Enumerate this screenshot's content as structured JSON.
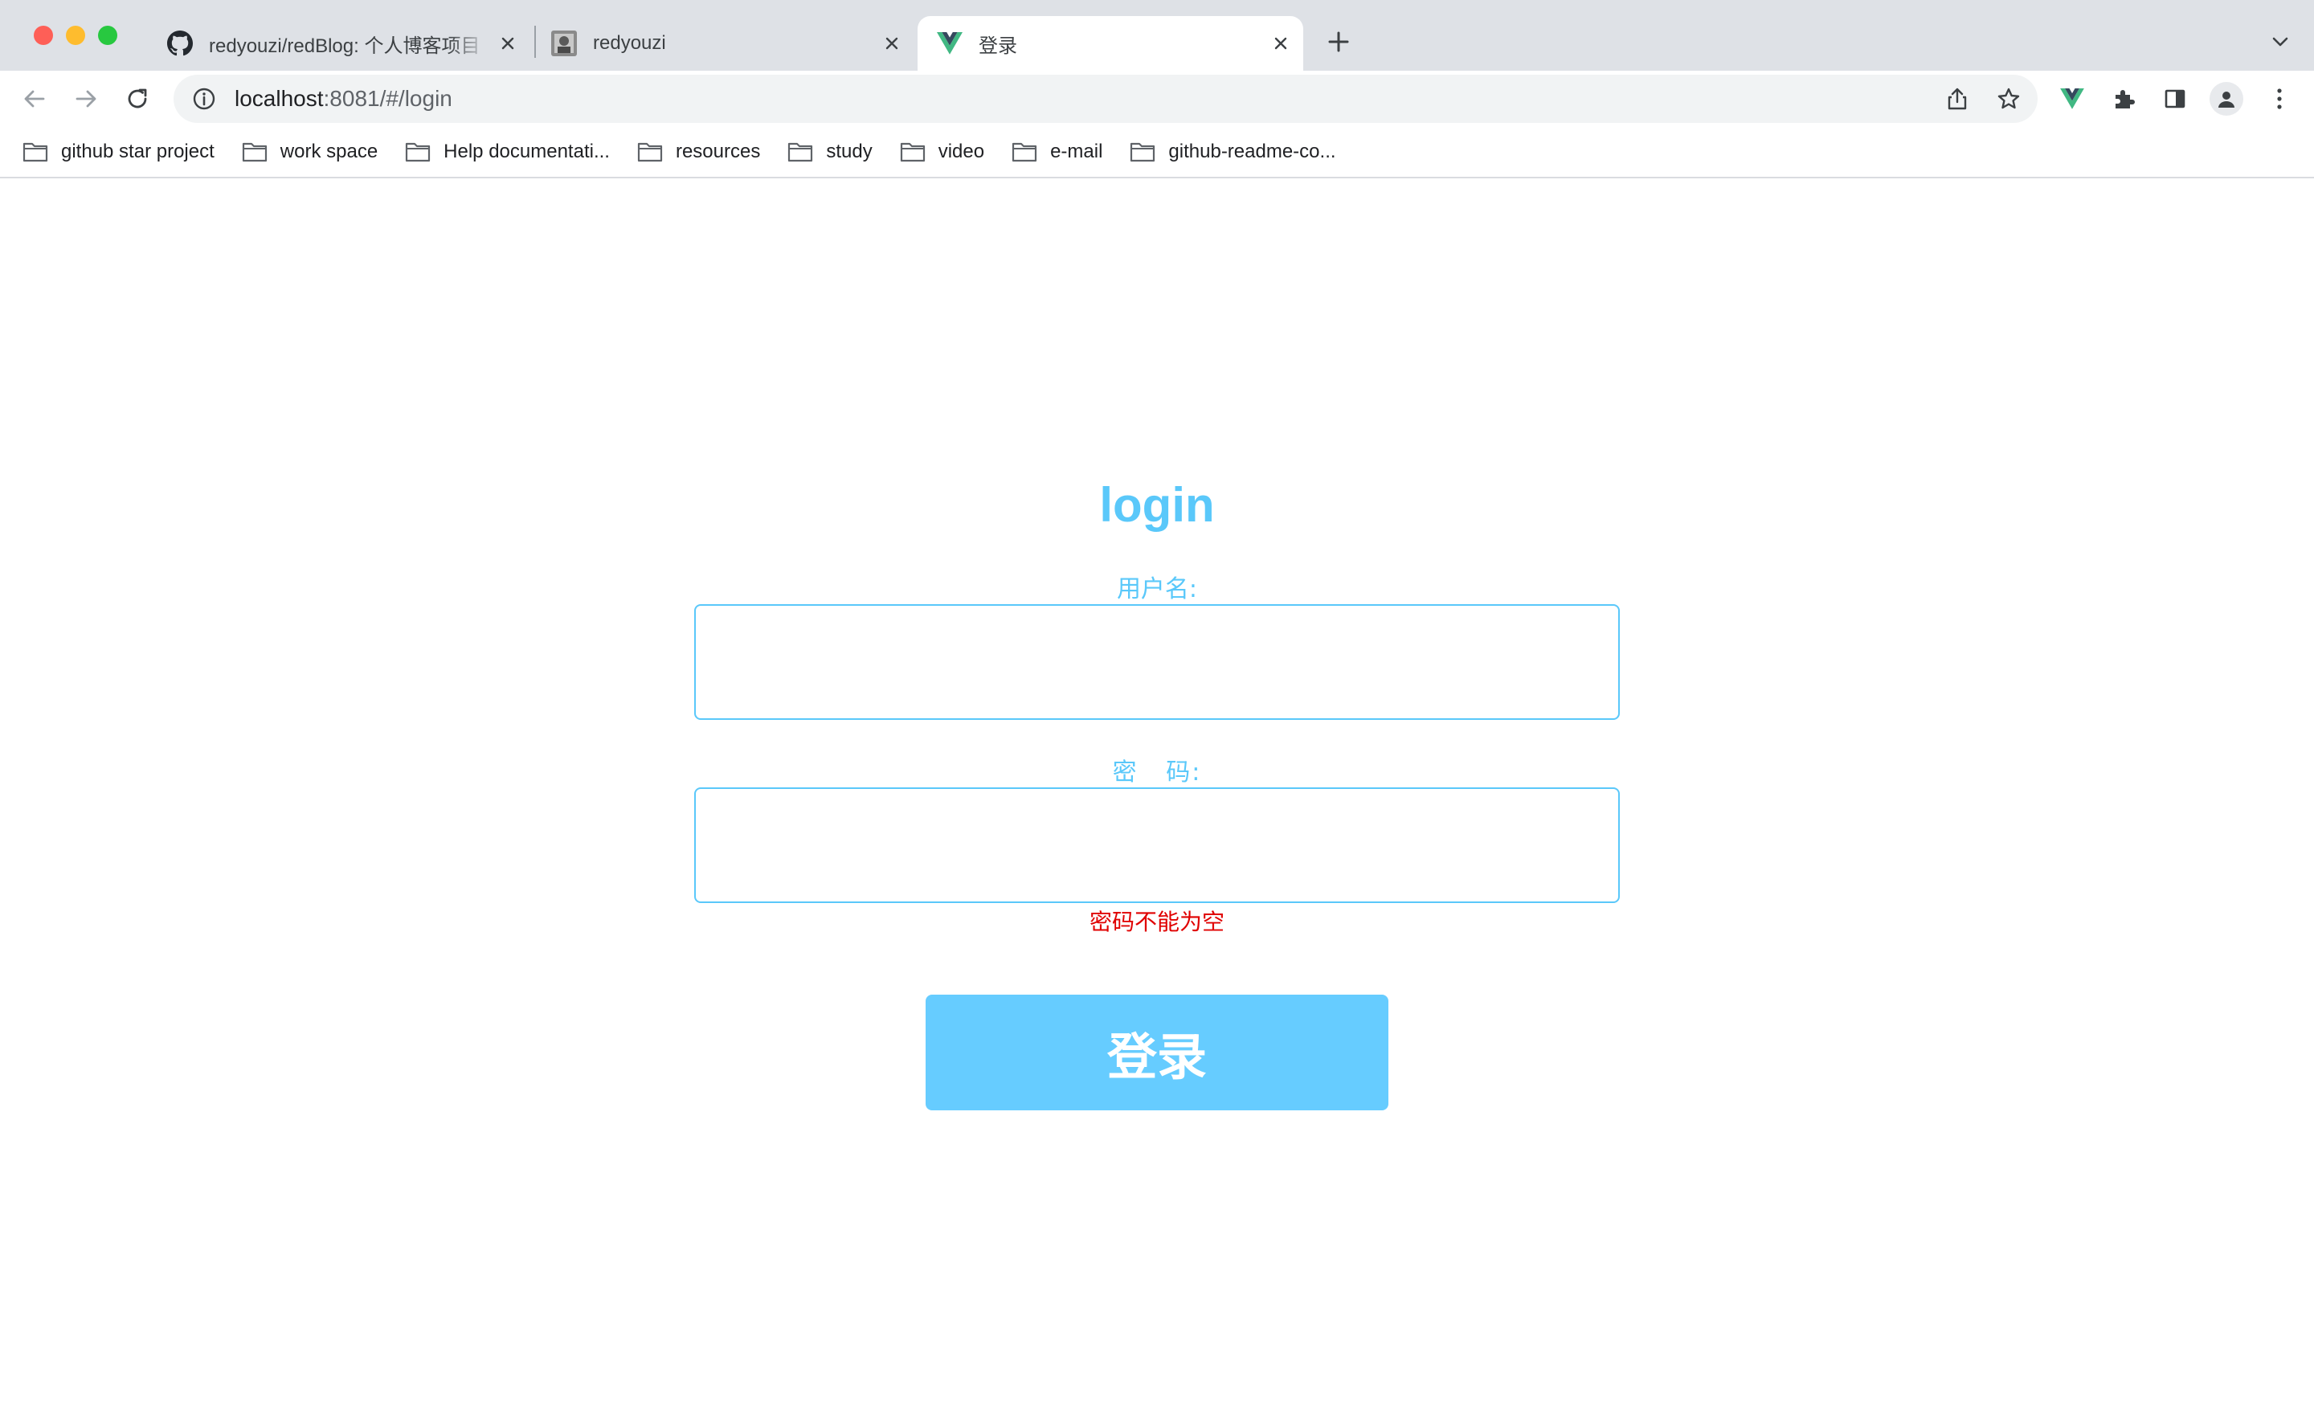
{
  "browser": {
    "tabs": [
      {
        "title": "redyouzi/redBlog: 个人博客项目",
        "favicon": "github-icon"
      },
      {
        "title": "redyouzi",
        "favicon": "avatar-icon"
      },
      {
        "title": "登录",
        "favicon": "vue-icon",
        "active": true
      }
    ],
    "address": {
      "host": "localhost",
      "rest": ":8081/#/login"
    },
    "bookmarks": [
      "github star project",
      "work space",
      "Help documentati...",
      "resources",
      "study",
      "video",
      "e-mail",
      "github-readme-co..."
    ]
  },
  "login": {
    "title": "login",
    "username_label": "用户名:",
    "username_value": "",
    "password_label": "密   码:",
    "password_value": "",
    "error": "密码不能为空",
    "submit_label": "登录"
  },
  "colors": {
    "accent": "#5ac8fa",
    "button": "#66ccff",
    "error": "#e00000"
  }
}
